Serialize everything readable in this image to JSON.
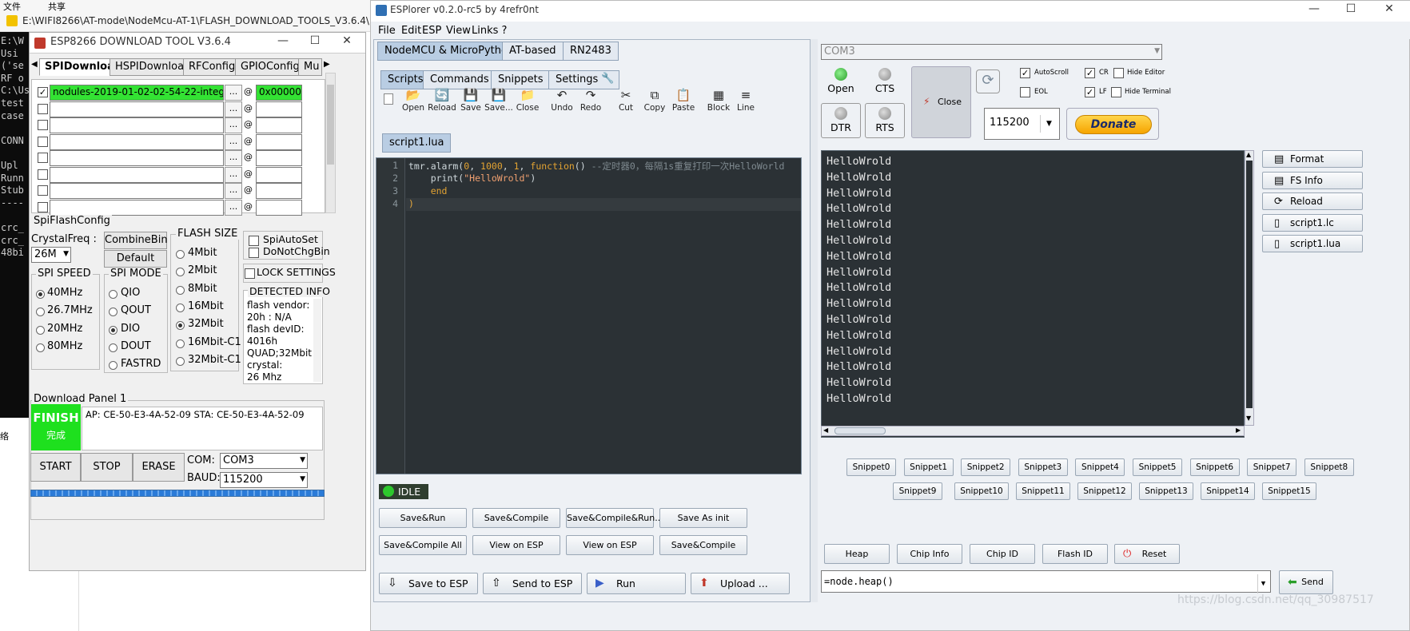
{
  "explorer": {
    "menu": [
      "文件",
      "共享"
    ],
    "path": "E:\\WIFI8266\\AT-mode\\NodeMcu-AT-1\\FLASH_DOWNLOAD_TOOLS_V3.6.4\\",
    "console_lines": [
      "E:\\W",
      "Usi",
      "('se",
      "RF o",
      "C:\\Us",
      "test",
      "case",
      "",
      "CONN",
      "",
      "Upl",
      "Runn",
      "Stub",
      "----",
      "",
      "crc_",
      "crc_",
      "48bi"
    ],
    "side_char": "络"
  },
  "dltool": {
    "title": "ESP8266 DOWNLOAD TOOL V3.6.4",
    "tabs": [
      "SPIDownload",
      "HSPIDownload",
      "RFConfig",
      "GPIOConfig",
      "Mu"
    ],
    "file1": "nodules-2019-01-02-02-54-22-integer.bin",
    "addr1": "0x00000",
    "dots": "...",
    "at": "@",
    "spiflash_label": "SpiFlashConfig",
    "crystal_label": "CrystalFreq :",
    "crystal_value": "26M",
    "combine_btn": "CombineBin",
    "default_btn": "Default",
    "flash_size_label": "FLASH SIZE",
    "flash_sizes": [
      "4Mbit",
      "2Mbit",
      "8Mbit",
      "16Mbit",
      "32Mbit",
      "16Mbit-C1",
      "32Mbit-C1"
    ],
    "spiauto": "SpiAutoSet",
    "donotchg": "DoNotChgBin",
    "lock": "LOCK SETTINGS",
    "detected_label": "DETECTED INFO",
    "detected_lines": [
      "flash vendor:",
      "20h : N/A",
      "flash devID:",
      "4016h",
      "QUAD;32Mbit",
      "crystal:",
      "26 Mhz"
    ],
    "spi_speed_label": "SPI SPEED",
    "speeds": [
      "40MHz",
      "26.7MHz",
      "20MHz",
      "80MHz"
    ],
    "spi_mode_label": "SPI MODE",
    "modes": [
      "QIO",
      "QOUT",
      "DIO",
      "DOUT",
      "FASTRD"
    ],
    "panel_label": "Download Panel 1",
    "finish": "FINISH",
    "finish_cn": "完成",
    "ap_info": "AP:  CE-50-E3-4A-52-09   STA:  CE-50-E3-4A-52-09",
    "start": "START",
    "stop": "STOP",
    "erase": "ERASE",
    "com_label": "COM:",
    "com_value": "COM3",
    "baud_label": "BAUD:",
    "baud_value": "115200"
  },
  "esplorer": {
    "title": "ESPlorer v0.2.0-rc5 by 4refr0nt",
    "menu": [
      "File",
      "Edit",
      "ESP",
      "View",
      "Links ?"
    ],
    "top_tabs": [
      "NodeMCU & MicroPython",
      "AT-based",
      "RN2483"
    ],
    "sub_tabs": [
      "Scripts",
      "Commands",
      "Snippets",
      "Settings"
    ],
    "toolbar": [
      "Open",
      "Reload",
      "Save",
      "Save...",
      "Close",
      "Undo",
      "Redo",
      "Cut",
      "Copy",
      "Paste",
      "Block",
      "Line"
    ],
    "file_tab": "script1.lua",
    "code": {
      "l1_a": "tmr.alarm(",
      "l1_b": "0",
      "l1_c": ", ",
      "l1_d": "1000",
      "l1_e": ", ",
      "l1_f": "1",
      "l1_g": ", ",
      "l1_h": "function",
      "l1_i": "() ",
      "l1_j": "--定时器0，每隔1s重复打印一次HelloWorld",
      "l2_a": "    print(",
      "l2_b": "\"HelloWrold\"",
      "l2_c": ")",
      "l3": "    end",
      "l4": ")"
    },
    "line_numbers": [
      "1",
      "2",
      "3",
      "4"
    ],
    "status": "IDLE",
    "buttons_row1": [
      "Save&Run",
      "Save&Compile",
      "Save&Compile&Run...",
      "Save As init"
    ],
    "buttons_row2": [
      "Save&Compile All",
      "View on ESP",
      "View on ESP",
      "Save&Compile"
    ],
    "save_to_esp": "Save to ESP",
    "send_to_esp": "Send to ESP",
    "run": "Run",
    "upload": "Upload ...",
    "port_value": "COM3",
    "open": "Open",
    "cts": "CTS",
    "dtr": "DTR",
    "rts": "RTS",
    "close": "Close",
    "autoscroll": "AutoScroll",
    "cr": "CR",
    "hide_editor": "Hide Editor",
    "edl": "EOL",
    "lf": "LF",
    "hide_terminal": "Hide Terminal",
    "baud": "115200",
    "donate": "Donate",
    "terminal_lines": [
      "HelloWrold",
      "HelloWrold",
      "HelloWrold",
      "HelloWrold",
      "HelloWrold",
      "HelloWrold",
      "HelloWrold",
      "HelloWrold",
      "HelloWrold",
      "HelloWrold",
      "HelloWrold",
      "HelloWrold",
      "HelloWrold",
      "HelloWrold",
      "HelloWrold",
      "HelloWrold"
    ],
    "right_buttons": [
      "Format",
      "FS Info",
      "Reload",
      "script1.lc",
      "script1.lua"
    ],
    "snippets_row1": [
      "Snippet0",
      "Snippet1",
      "Snippet2",
      "Snippet3",
      "Snippet4",
      "Snippet5",
      "Snippet6",
      "Snippet7",
      "Snippet8"
    ],
    "snippets_row2": [
      "Snippet9",
      "Snippet10",
      "Snippet11",
      "Snippet12",
      "Snippet13",
      "Snippet14",
      "Snippet15"
    ],
    "bottom_buttons": [
      "Heap",
      "Chip Info",
      "Chip ID",
      "Flash ID",
      "Reset"
    ],
    "command_value": "=node.heap()",
    "send": "Send",
    "watermark": "https://blog.csdn.net/qq_30987517"
  },
  "colors": {
    "finish_green": "#1ee01e",
    "file_green": "#33e233",
    "progress_blue": "#2b7bd8",
    "led_green": "#2dc82d",
    "donate": "#f6b800"
  }
}
